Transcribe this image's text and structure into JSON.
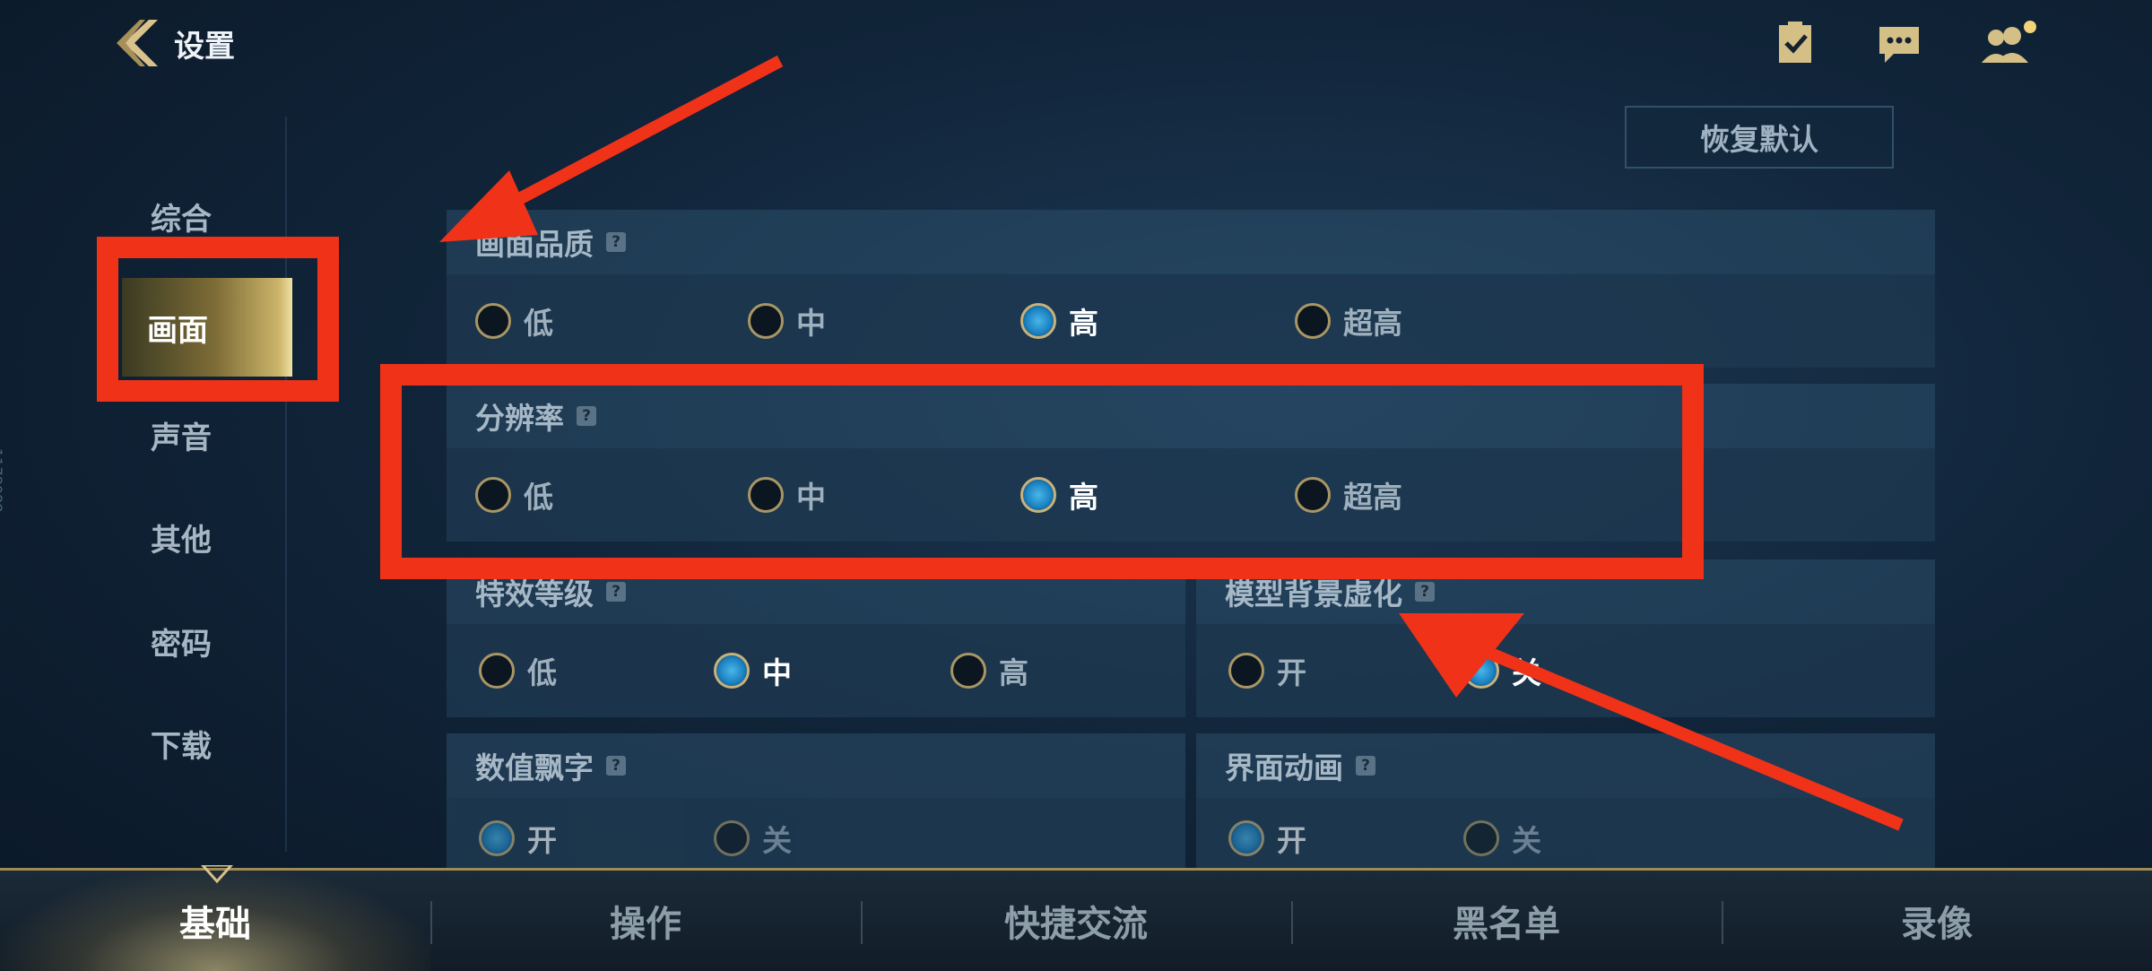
{
  "header": {
    "back_title": "设置",
    "icons": [
      "clipboard-check-icon",
      "chat-icon",
      "friends-icon"
    ],
    "restore_label": "恢复默认"
  },
  "sidebar": {
    "items": [
      {
        "label": "综合"
      },
      {
        "label": "画面"
      },
      {
        "label": "声音"
      },
      {
        "label": "其他"
      },
      {
        "label": "密码"
      },
      {
        "label": "下载"
      }
    ],
    "active": "画面"
  },
  "settings": {
    "quality": {
      "title": "画面品质",
      "help": "?",
      "options": [
        "低",
        "中",
        "高",
        "超高"
      ],
      "selected": "高"
    },
    "resolution": {
      "title": "分辨率",
      "help": "?",
      "options": [
        "低",
        "中",
        "高",
        "超高"
      ],
      "selected": "高"
    },
    "effects": {
      "title": "特效等级",
      "help": "?",
      "options": [
        "低",
        "中",
        "高"
      ],
      "selected": "中"
    },
    "blur": {
      "title": "模型背景虚化",
      "help": "?",
      "options": [
        "开",
        "关"
      ],
      "selected": "关"
    },
    "damage_text": {
      "title": "数值飘字",
      "help": "?",
      "options": [
        "开",
        "关"
      ],
      "selected": "开"
    },
    "ui_anim": {
      "title": "界面动画",
      "help": "?",
      "options": [
        "开",
        "关"
      ],
      "selected": "开"
    }
  },
  "bottom_tabs": {
    "items": [
      "基础",
      "操作",
      "快捷交流",
      "黑名单",
      "录像"
    ],
    "active": "基础"
  },
  "watermark": "1178088",
  "colors": {
    "annotation_red": "#f03219",
    "accent_gold": "#c8b27a",
    "selected_blue": "#1d84c4"
  }
}
